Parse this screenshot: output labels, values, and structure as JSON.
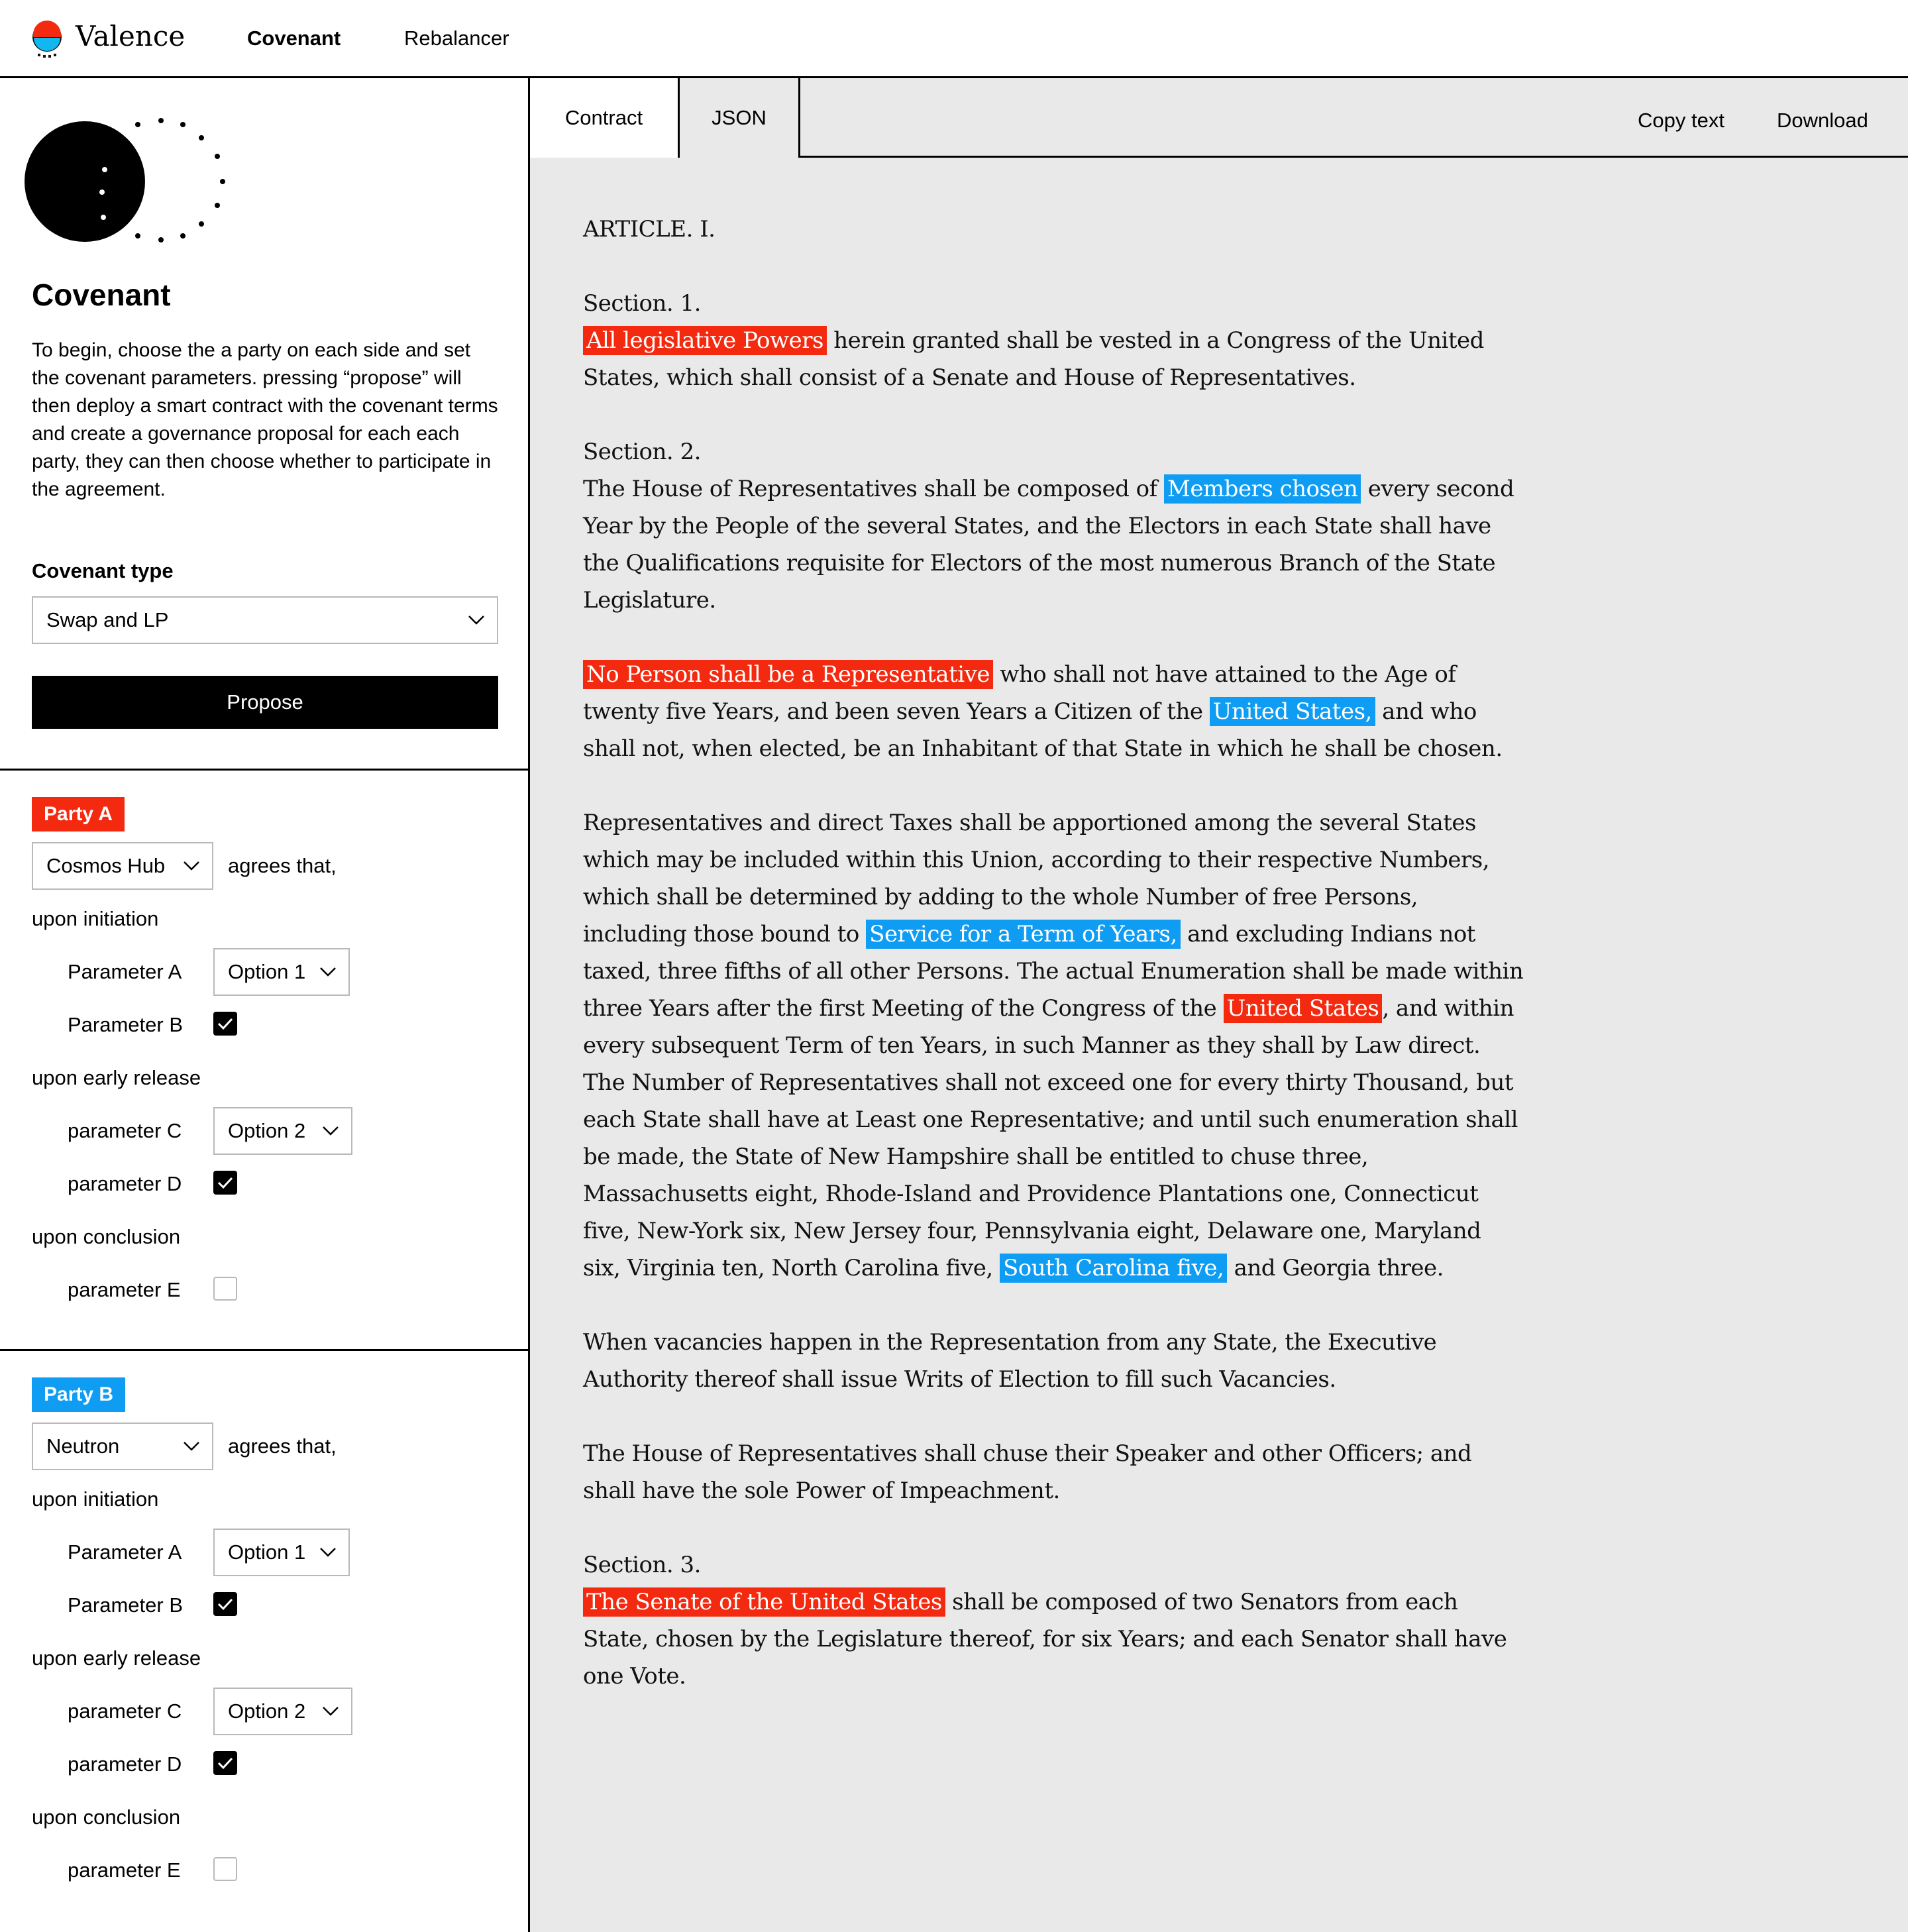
{
  "app": {
    "brand": "Valence",
    "nav": [
      "Covenant",
      "Rebalancer"
    ],
    "colors": {
      "party_a": "#f42a10",
      "party_b": "#0f9cf3"
    }
  },
  "left": {
    "title": "Covenant",
    "description": "To begin, choose the a party on each side and set the covenant parameters. pressing “propose” will then deploy a smart contract with the covenant terms and create a governance proposal for each each party, they can then choose whether to participate in the agreement.",
    "covenant_type_label": "Covenant type",
    "covenant_type_value": "Swap and LP",
    "propose_label": "Propose"
  },
  "parties": [
    {
      "badge": "Party A",
      "chain": "Cosmos Hub",
      "agrees": "agrees that,",
      "initiation_label": "upon initiation",
      "param_a_label": "Parameter A",
      "param_a_value": "Option 1",
      "param_b_label": "Parameter B",
      "param_b_checked": true,
      "early_label": "upon early release",
      "param_c_label": "parameter C",
      "param_c_value": "Option 2",
      "param_d_label": "parameter D",
      "param_d_checked": true,
      "conclusion_label": "upon conclusion",
      "param_e_label": "parameter E",
      "param_e_checked": false
    },
    {
      "badge": "Party B",
      "chain": "Neutron",
      "agrees": "agrees that,",
      "initiation_label": "upon initiation",
      "param_a_label": "Parameter A",
      "param_a_value": "Option 1",
      "param_b_label": "Parameter B",
      "param_b_checked": true,
      "early_label": "upon early release",
      "param_c_label": "parameter C",
      "param_c_value": "Option 2",
      "param_d_label": "parameter D",
      "param_d_checked": true,
      "conclusion_label": "upon conclusion",
      "param_e_label": "parameter E",
      "param_e_checked": false
    }
  ],
  "right": {
    "tabs": [
      "Contract",
      "JSON"
    ],
    "actions": [
      "Copy text",
      "Download"
    ]
  },
  "contract": {
    "article": "ARTICLE. I.",
    "s1_heading": "Section. 1.",
    "s1_h1": "All legislative Powers",
    "s1_t1": " herein granted shall be vested in a Congress of the United States, which shall consist of a Senate and House of Representatives.",
    "s2_heading": "Section. 2.",
    "s2p1_t1": "The House of Representatives shall be composed of ",
    "s2p1_h1": "Members chosen",
    "s2p1_t2": " every second Year by the People of the several States, and the Electors in each State shall have the Qualifications requisite for Electors of the most numerous Branch of the State Legislature.",
    "s2p2_h1": "No Person shall be a Representative",
    "s2p2_t1": " who shall not have attained to the Age of twenty five Years, and been seven Years a Citizen of the ",
    "s2p2_h2": "United States,",
    "s2p2_t2": " and who shall not, when elected, be an Inhabitant of that State in which he shall be chosen.",
    "s2p3_t1": "Representatives and direct Taxes shall be apportioned among the several States which may be included within this Union, according to their respective Numbers, which shall be determined by adding to the whole Number of free Persons, including those bound to ",
    "s2p3_h1": "Service for a Term of Years,",
    "s2p3_t2": " and excluding Indians not taxed, three fifths of all other Persons. The actual Enumeration shall be made within three Years after the first Meeting of the Congress of the ",
    "s2p3_h2": "United States",
    "s2p3_t3": ", and within every subsequent Term of ten Years, in such Manner as they shall by Law direct. The Number of Representatives shall not exceed one for every thirty Thousand, but each State shall have at Least one Representative; and until such enumeration shall be made, the State of New Hampshire shall be entitled to chuse three, Massachusetts eight, Rhode-Island and Providence Plantations one, Connecticut five, New-York six, New Jersey four, Pennsylvania eight, Delaware one, Maryland six, Virginia ten, North Carolina five, ",
    "s2p3_h3": "South Carolina five,",
    "s2p3_t4": " and Georgia three.",
    "s2p4": "When vacancies happen in the Representation from any State, the Executive Authority thereof shall issue Writs of Election to fill such Vacancies.",
    "s2p5": "The House of Representatives shall chuse their Speaker and other Officers; and shall have the sole Power of Impeachment.",
    "s3_heading": "Section. 3.",
    "s3_h1": "The Senate of the United States",
    "s3_t1": " shall be composed of two Senators from each State, chosen by the Legislature thereof, for six Years; and each Senator shall have one Vote."
  }
}
